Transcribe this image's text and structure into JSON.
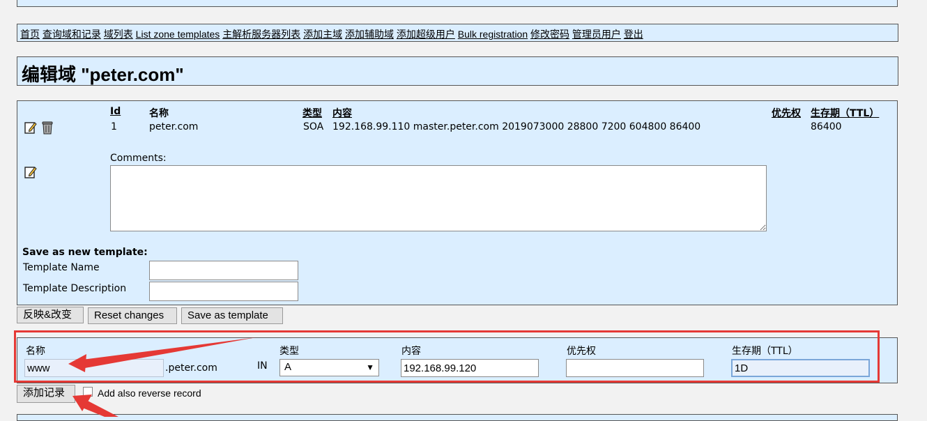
{
  "nav": {
    "items": [
      "首页",
      "查询域和记录",
      "域列表",
      "List zone templates",
      "主解析服务器列表",
      "添加主域",
      "添加辅助域",
      "添加超级用户",
      "Bulk registration",
      "修改密码",
      "管理员用户",
      "登出"
    ]
  },
  "page": {
    "title": "编辑域 \"peter.com\""
  },
  "records": {
    "headers": {
      "id": "Id",
      "name": "名称",
      "type": "类型",
      "content": "内容",
      "priority": "优先权",
      "ttl": "生存期（TTL）"
    },
    "rows": [
      {
        "id": "1",
        "name": "peter.com",
        "type": "SOA",
        "content": "192.168.99.110 master.peter.com 2019073000 28800 7200 604800 86400",
        "priority": "",
        "ttl": "86400"
      }
    ],
    "comments_label": "Comments:",
    "comments_value": ""
  },
  "template": {
    "heading": "Save as new template:",
    "name_label": "Template Name",
    "desc_label": "Template Description",
    "name_value": "",
    "desc_value": ""
  },
  "buttons": {
    "apply": "反映&改变",
    "reset": "Reset changes",
    "save_template": "Save as template",
    "add_record": "添加记录"
  },
  "add_form": {
    "name_label": "名称",
    "type_label": "类型",
    "content_label": "内容",
    "priority_label": "优先权",
    "ttl_label": "生存期（TTL）",
    "name_value": "www",
    "domain_suffix": ".peter.com",
    "class": "IN",
    "type_value": "A",
    "content_value": "192.168.99.120",
    "priority_value": "",
    "ttl_value": "1D",
    "reverse_label": "Add also reverse record"
  },
  "colors": {
    "panel_bg": "#dbeeff",
    "highlight": "#e53935",
    "arrow": "#e53935"
  },
  "icons": [
    "edit-icon",
    "trash-icon",
    "edit-comment-icon",
    "dropdown-arrow-icon"
  ]
}
